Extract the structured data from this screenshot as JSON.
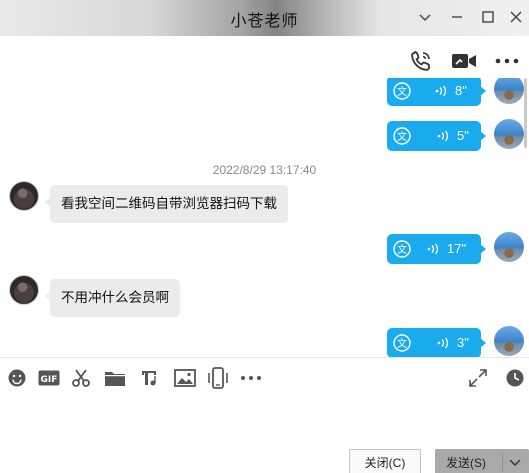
{
  "window": {
    "title": "小苍老师",
    "controls": [
      "chevron-down-icon",
      "minimize-icon",
      "maximize-icon",
      "close-icon"
    ]
  },
  "header_actions": [
    "voice-call-icon",
    "video-call-icon",
    "more-icon"
  ],
  "messages": [
    {
      "type": "voice",
      "sender": "me",
      "duration": "8\""
    },
    {
      "type": "voice",
      "sender": "me",
      "duration": "5\""
    },
    {
      "type": "timestamp",
      "text": "2022/8/29 13:17:40"
    },
    {
      "type": "text",
      "sender": "other",
      "text": "看我空间二维码自带浏览器扫码下载"
    },
    {
      "type": "voice",
      "sender": "me",
      "duration": "17\""
    },
    {
      "type": "text",
      "sender": "other",
      "text": "不用冲什么会员啊"
    },
    {
      "type": "voice",
      "sender": "me",
      "duration": "3\""
    }
  ],
  "input_toolbar": [
    "emoji-icon",
    "gif-icon",
    "scissors-icon",
    "folder-icon",
    "music-icon",
    "image-icon",
    "phone-shake-icon",
    "more-icon",
    "expand-icon",
    "history-icon"
  ],
  "buttons": {
    "close": "关闭(C)",
    "send": "发送(S)"
  },
  "colors": {
    "voice_bubble": "#1aabee",
    "text_bubble": "#ebebeb",
    "send_button": "#a9a9a9"
  }
}
